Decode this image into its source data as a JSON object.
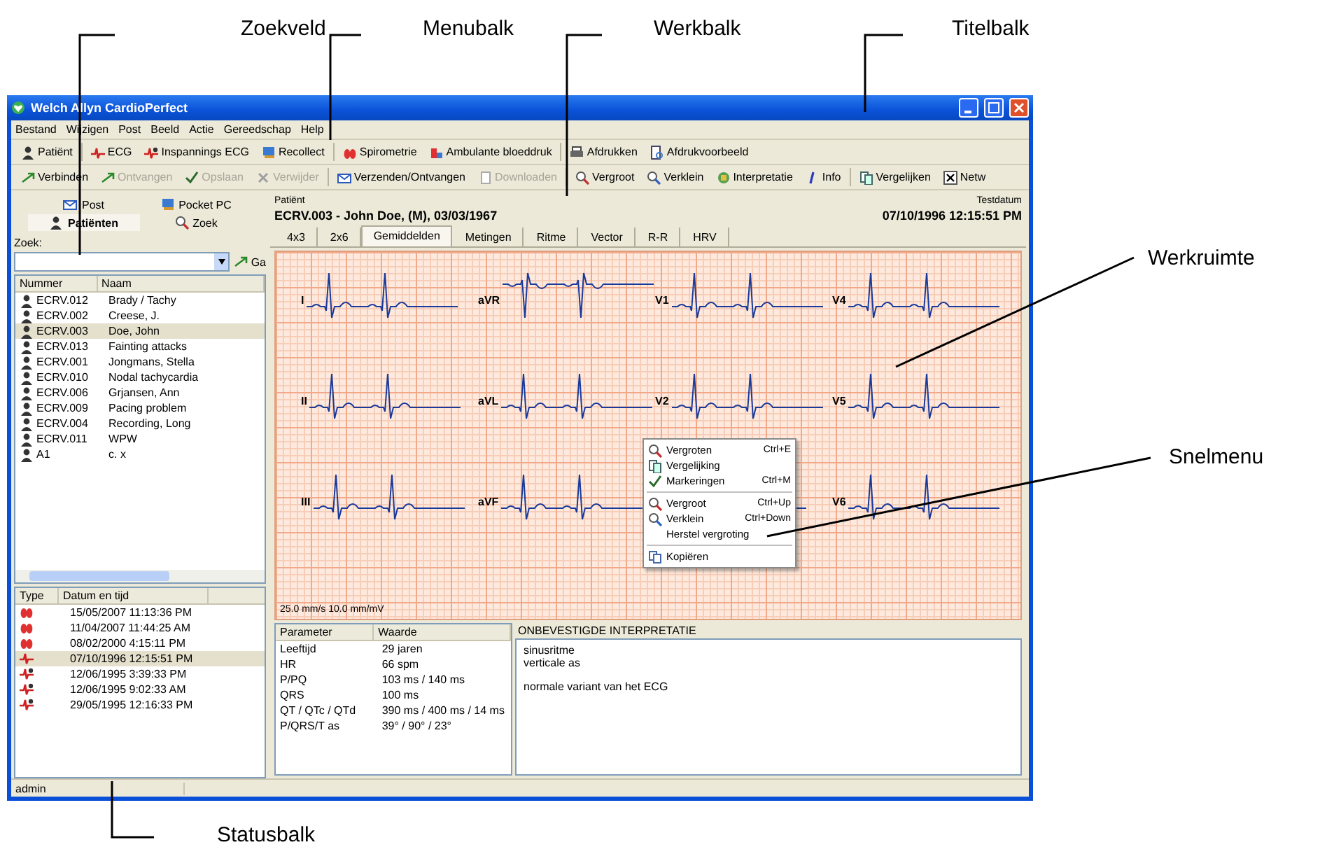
{
  "annotations": [
    {
      "label": "Zoekveld"
    },
    {
      "label": "Menubalk"
    },
    {
      "label": "Werkbalk"
    },
    {
      "label": "Titelbalk"
    },
    {
      "label": "Werkruimte"
    },
    {
      "label": "Snelmenu"
    },
    {
      "label": "Statusbalk"
    }
  ],
  "window": {
    "title": "Welch Allyn CardioPerfect"
  },
  "menu": [
    "Bestand",
    "Wijzigen",
    "Post",
    "Beeld",
    "Actie",
    "Gereedschap",
    "Help"
  ],
  "toolbar": [
    {
      "label": "Patiënt",
      "kind": "patient",
      "disabled": false
    },
    {
      "label": "ECG",
      "kind": "ecg",
      "disabled": false
    },
    {
      "label": "Inspannings ECG",
      "kind": "stress",
      "disabled": false
    },
    {
      "label": "Recollect",
      "kind": "recollect",
      "disabled": false
    },
    {
      "label": "Spirometrie",
      "kind": "spiro",
      "disabled": false
    },
    {
      "label": "Ambulante bloeddruk",
      "kind": "bp",
      "disabled": false
    },
    {
      "label": "Afdrukken",
      "kind": "print",
      "disabled": false
    },
    {
      "label": "Afdrukvoorbeeld",
      "kind": "preview",
      "disabled": false
    }
  ],
  "toolbar2": [
    {
      "label": "Verbinden",
      "kind": "send",
      "disabled": false
    },
    {
      "label": "Ontvangen",
      "kind": "send",
      "disabled": true
    },
    {
      "label": "Opslaan",
      "kind": "check",
      "disabled": true
    },
    {
      "label": "Verwijder",
      "kind": "cross",
      "disabled": true
    },
    {
      "label": "Verzenden/Ontvangen",
      "kind": "sendrecv",
      "disabled": false
    },
    {
      "label": "Downloaden",
      "kind": "download",
      "disabled": true
    },
    {
      "label": "Vergroot",
      "kind": "zoomin",
      "disabled": false
    },
    {
      "label": "Verklein",
      "kind": "zoomout",
      "disabled": false
    },
    {
      "label": "Interpretatie",
      "kind": "interp",
      "disabled": false
    },
    {
      "label": "Info",
      "kind": "info",
      "disabled": false
    },
    {
      "label": "Vergelijken",
      "kind": "compare",
      "disabled": false
    },
    {
      "label": "Netw",
      "kind": "checkbox",
      "checked": true
    }
  ],
  "left_panel": {
    "tabs": [
      {
        "label": "Post",
        "selected": false
      },
      {
        "label": "Pocket PC",
        "selected": false
      },
      {
        "label": "Patiënten",
        "selected": true
      },
      {
        "label": "Zoek",
        "selected": false
      }
    ],
    "search": {
      "label": "Zoek:",
      "button": "Ga"
    },
    "patients": {
      "columns": [
        "Nummer",
        "Naam"
      ],
      "rows": [
        {
          "number": "ECRV.012",
          "name": "Brady / Tachy",
          "selected": false
        },
        {
          "number": "ECRV.002",
          "name": "Creese, J.",
          "selected": false
        },
        {
          "number": "ECRV.003",
          "name": "Doe, John",
          "selected": true
        },
        {
          "number": "ECRV.013",
          "name": "Fainting attacks",
          "selected": false
        },
        {
          "number": "ECRV.001",
          "name": "Jongmans, Stella",
          "selected": false
        },
        {
          "number": "ECRV.010",
          "name": "Nodal tachycardia",
          "selected": false
        },
        {
          "number": "ECRV.006",
          "name": "Grjansen, Ann",
          "selected": false
        },
        {
          "number": "ECRV.009",
          "name": "Pacing problem",
          "selected": false
        },
        {
          "number": "ECRV.004",
          "name": "Recording, Long",
          "selected": false
        },
        {
          "number": "ECRV.011",
          "name": "WPW",
          "selected": false
        },
        {
          "number": "A1",
          "name": "c. x",
          "selected": false
        }
      ]
    },
    "exams": {
      "columns": [
        "Type",
        "Datum en tijd"
      ],
      "rows": [
        {
          "kind": "spiro",
          "date": "15/05/2007 11:13:36 PM",
          "selected": false
        },
        {
          "kind": "spiro",
          "date": "11/04/2007 11:44:25 AM",
          "selected": false
        },
        {
          "kind": "spiro",
          "date": "08/02/2000 4:15:11 PM",
          "selected": false
        },
        {
          "kind": "ecg",
          "date": "07/10/1996 12:15:51 PM",
          "selected": true
        },
        {
          "kind": "stress",
          "date": "12/06/1995 3:39:33 PM",
          "selected": false
        },
        {
          "kind": "stress",
          "date": "12/06/1995 9:02:33 AM",
          "selected": false
        },
        {
          "kind": "stress",
          "date": "29/05/1995 12:16:33 PM",
          "selected": false
        }
      ]
    }
  },
  "workspace": {
    "patient_label": "Patiënt",
    "patient": "ECRV.003 - John Doe, (M), 03/03/1967",
    "date_label": "Testdatum",
    "date": "07/10/1996 12:15:51 PM",
    "tabs": [
      {
        "label": "4x3",
        "selected": false
      },
      {
        "label": "2x6",
        "selected": false
      },
      {
        "label": "Gemiddelden",
        "selected": true
      },
      {
        "label": "Metingen",
        "selected": false
      },
      {
        "label": "Ritme",
        "selected": false
      },
      {
        "label": "Vector",
        "selected": false
      },
      {
        "label": "R-R",
        "selected": false
      },
      {
        "label": "HRV",
        "selected": false
      }
    ],
    "leads": [
      "I",
      "aVR",
      "V1",
      "V4",
      "II",
      "aVL",
      "V2",
      "V5",
      "III",
      "aVF",
      "V6"
    ],
    "scale": "25.0 mm/s 10.0 mm/mV",
    "context_menu": [
      {
        "kind": "item",
        "label": "Vergroten",
        "shortcut": "Ctrl+E"
      },
      {
        "kind": "item",
        "label": "Vergelijking"
      },
      {
        "kind": "item",
        "label": "Markeringen",
        "shortcut": "Ctrl+M"
      },
      {
        "kind": "separator"
      },
      {
        "kind": "item",
        "label": "Vergroot",
        "shortcut": "Ctrl+Up"
      },
      {
        "kind": "item",
        "label": "Verklein",
        "shortcut": "Ctrl+Down"
      },
      {
        "kind": "item",
        "label": "Herstel vergroting"
      },
      {
        "kind": "separator"
      },
      {
        "kind": "item",
        "label": "Kopiëren"
      }
    ],
    "parameters": {
      "columns": [
        "Parameter",
        "Waarde"
      ],
      "rows": [
        [
          "Leeftijd",
          "29 jaren"
        ],
        [
          "HR",
          "66 spm"
        ],
        [
          "P/PQ",
          "103 ms / 140 ms"
        ],
        [
          "QRS",
          "100 ms"
        ],
        [
          "QT / QTc / QTd",
          "390 ms / 400 ms / 14 ms"
        ],
        [
          "P/QRS/T as",
          "39° / 90° / 23°"
        ]
      ]
    },
    "interpretation": {
      "title": "ONBEVESTIGDE INTERPRETATIE",
      "paragraphs": [
        [
          "sinusritme",
          "verticale as"
        ],
        [
          "normale variant van het ECG"
        ]
      ]
    }
  },
  "status_bar": "admin"
}
